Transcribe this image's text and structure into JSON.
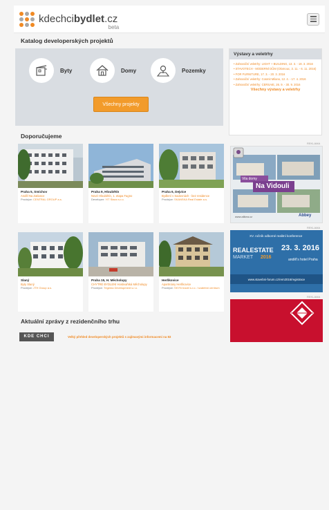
{
  "header": {
    "logo_part1": "kde",
    "logo_part2": "chci",
    "logo_part3": "bydlet",
    "logo_suffix": ".cz",
    "beta": "beta",
    "menu_icon": "hamburger-menu-icon"
  },
  "catalog": {
    "title": "Katalog developerských projektů",
    "items": [
      {
        "label": "Byty",
        "icon": "apartment-icon"
      },
      {
        "label": "Domy",
        "icon": "house-icon"
      },
      {
        "label": "Pozemky",
        "icon": "land-plot-icon"
      }
    ],
    "all_button": "Všechny projekty"
  },
  "events": {
    "title": "Výstavy a veletrhy",
    "items": [
      "Zahraniční veletrhy: LIGHT + BUILDING, 13. 3. - 18. 3. 2016",
      "STAVOTECH - MODERNÍ DŮM (Olomouc, 3. 11. - 6. 11. 2016)",
      "FOR FURNITURE, 17. 3. - 20. 3. 2016",
      "Zahraniční veletrhy: Cosmit Milano, 12. 4. - 17. 4. 2016",
      "Zahraniční veletrhy: CERSAIE, 26. 9. - 30. 9. 2016"
    ],
    "all_link": "Všechny výstavy a veletrhy"
  },
  "recommended": {
    "title": "Doporučujeme",
    "cards": [
      {
        "title": "Praha 5, Smíchov",
        "subtitle": "Anděl Na Zatlance",
        "seller_label": "Prodejce:",
        "seller": "CENTRAL GROUP a.s."
      },
      {
        "title": "Praha 9, Hloubětín",
        "subtitle": "Nové Hloubětín, 1. etapa Fagno",
        "seller_label": "Developer:",
        "seller": "YIT Stavo s.r.o."
      },
      {
        "title": "Praha 6, Dejvice",
        "subtitle": "Bydlení v Sadovnách - bez residence",
        "seller_label": "Prodejce:",
        "seller": "SKANSKA Real Estate a.s."
      },
      {
        "title": "Slaný",
        "subtitle": "Byty Slaný",
        "seller_label": "Prodejce:",
        "seller": "JTH Group a.s."
      },
      {
        "title": "Praha 15, H. Měcholupy",
        "subtitle": "CHYTRÉ BYDLENÍ Hostivařská Měcholupy",
        "seller_label": "Prodejce:",
        "seller": "Trigema Development s.r.o."
      },
      {
        "title": "Herlíkovice",
        "subtitle": "Apartmány Herlíkovice",
        "seller_label": "Prodejce:",
        "seller": "SKYN travel s.r.o. / svatební centrum"
      }
    ]
  },
  "ads": {
    "label": "REKLAMA",
    "vidouli_tag": "Vila domy",
    "vidouli_title": "Na Vidouli",
    "vidouli_url": "www.alikea.cz",
    "vidouli_brand": "Abbey",
    "realestate_top": "XV. ročník odborné realitní konference",
    "realestate_name": "REALESTATE",
    "realestate_market": "MARKET",
    "realestate_year": "2016",
    "realestate_date": "23. 3. 2016",
    "realestate_place": "anděl's hotel Praha",
    "realestate_url": "www.stavebni-forum.cz/rem2016/registrace"
  },
  "news": {
    "title": "Aktuální zprávy z rezidenčního trhu",
    "logo": "KDE CHCI",
    "headline": "Velký přehled developerských projektů s zajímavými informacemi na 83"
  },
  "colors": {
    "accent": "#f08a24",
    "panel": "#d9dde2",
    "background": "#f4f4f4"
  }
}
